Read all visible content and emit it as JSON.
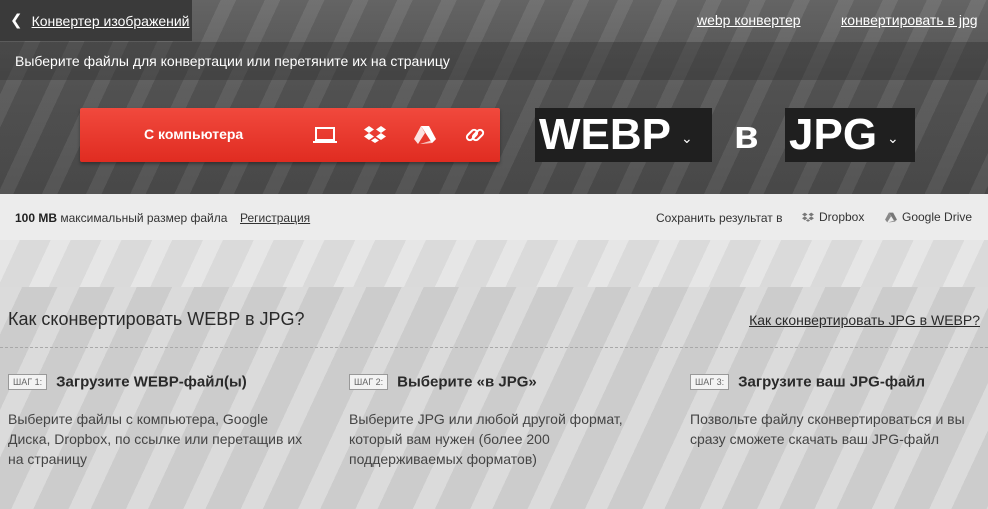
{
  "header": {
    "back_label": "Конвертер изображений",
    "links": [
      "webp конвертер",
      "конвертировать в jpg"
    ],
    "instruction": "Выберите файлы для конвертации или перетяните их на страницу"
  },
  "upload": {
    "button_label": "С компьютера",
    "sources": [
      "laptop-icon",
      "dropbox-icon",
      "google-drive-icon",
      "link-icon"
    ]
  },
  "conversion": {
    "from": "WEBP",
    "to_word": "в",
    "to": "JPG"
  },
  "info": {
    "max_size_value": "100 MB",
    "max_size_text": "максимальный размер файла",
    "register_label": "Регистрация",
    "save_to": "Сохранить результат в",
    "dest_dropbox": "Dropbox",
    "dest_gdrive": "Google Drive"
  },
  "howto": {
    "title": "Как сконвертировать WEBP в JPG?",
    "reverse_link": "Как сконвертировать JPG в WEBP?",
    "steps": [
      {
        "badge": "ШАГ 1:",
        "title": "Загрузите WEBP-файл(ы)",
        "desc": "Выберите файлы с компьютера, Google Диска, Dropbox, по ссылке или перетащив их на страницу"
      },
      {
        "badge": "ШАГ 2:",
        "title": "Выберите «в JPG»",
        "desc": "Выберите JPG или любой другой формат, который вам нужен (более 200 поддерживаемых форматов)"
      },
      {
        "badge": "ШАГ 3:",
        "title": "Загрузите ваш JPG-файл",
        "desc": "Позвольте файлу сконвертироваться и вы сразу сможете скачать ваш JPG-файл"
      }
    ]
  },
  "colors": {
    "accent": "#e8352a",
    "format_bg": "#1f1f1f",
    "topbar_bg": "#3a3a3a"
  }
}
